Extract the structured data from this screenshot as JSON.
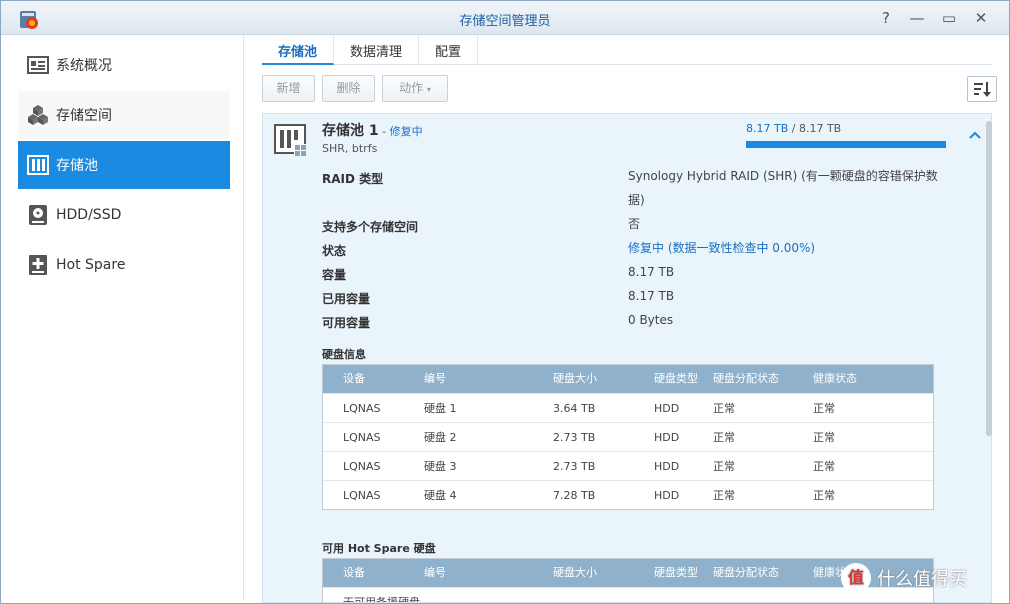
{
  "window": {
    "title": "存储空间管理员",
    "help": "?",
    "minimize": "—",
    "maximize": "▭",
    "close": "✕"
  },
  "sidebar": {
    "items": [
      {
        "label": "系统概况",
        "icon": "overview-icon"
      },
      {
        "label": "存储空间",
        "icon": "cubes-icon"
      },
      {
        "label": "存储池",
        "icon": "storage-pool-icon"
      },
      {
        "label": "HDD/SSD",
        "icon": "disk-icon"
      },
      {
        "label": "Hot Spare",
        "icon": "hot-spare-icon"
      }
    ],
    "active": "存储池"
  },
  "tabs": [
    "存储池",
    "数据清理",
    "配置"
  ],
  "toolbar": {
    "create": "新增",
    "delete": "删除",
    "action": "动作"
  },
  "pool": {
    "name": "存储池 1",
    "separator": " - ",
    "status": "修复中",
    "subtitle": "SHR, btrfs",
    "capacity_used": "8.17 TB",
    "capacity_sep": " / ",
    "capacity_total": "8.17 TB",
    "used_fraction": 1.0,
    "props": [
      {
        "label": "RAID 类型",
        "value": "Synology Hybrid RAID (SHR) (有一颗硬盘的容错保护数据)"
      },
      {
        "label": "支持多个存储空间",
        "value": "否"
      },
      {
        "label": "状态",
        "value": "修复中 (数据一致性检查中 0.00%)"
      },
      {
        "label": "容量",
        "value": "8.17 TB"
      },
      {
        "label": "已用容量",
        "value": "8.17 TB"
      },
      {
        "label": "可用容量",
        "value": "0 Bytes"
      }
    ]
  },
  "disk_info": {
    "title": "硬盘信息",
    "headers": [
      "设备",
      "编号",
      "硬盘大小",
      "硬盘类型",
      "硬盘分配状态",
      "健康状态"
    ],
    "rows": [
      [
        "LQNAS",
        "硬盘 1",
        "3.64 TB",
        "HDD",
        "正常",
        "正常"
      ],
      [
        "LQNAS",
        "硬盘 2",
        "2.73 TB",
        "HDD",
        "正常",
        "正常"
      ],
      [
        "LQNAS",
        "硬盘 3",
        "2.73 TB",
        "HDD",
        "正常",
        "正常"
      ],
      [
        "LQNAS",
        "硬盘 4",
        "7.28 TB",
        "HDD",
        "正常",
        "正常"
      ]
    ]
  },
  "hot_spare": {
    "title": "可用 Hot Spare 硬盘",
    "headers": [
      "设备",
      "编号",
      "硬盘大小",
      "硬盘类型",
      "硬盘分配状态",
      "健康状态"
    ],
    "empty": "无可用备援硬盘"
  },
  "watermark": {
    "logo": "值",
    "text": "什么值得买"
  },
  "colors": {
    "accent": "#1a8be0",
    "ok": "#2e9b2e",
    "table_header": "#8fb1cb",
    "panel_bg": "#eaf4fb"
  }
}
